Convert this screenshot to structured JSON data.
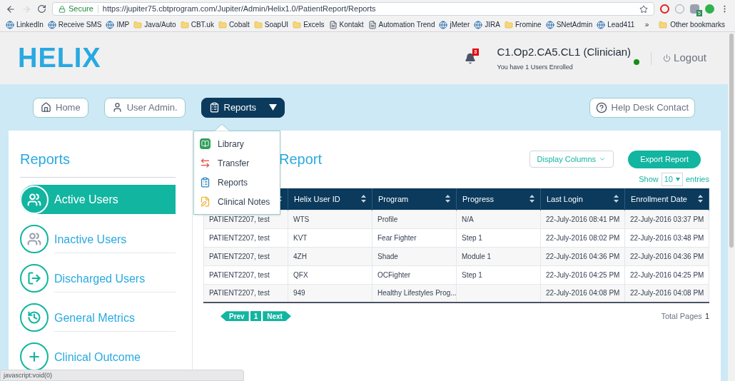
{
  "browser": {
    "secure_label": "Secure",
    "url": "https://jupiter75.cbtprogram.com/Jupiter/Admin/Helix1.0/PatientReport/Reports",
    "extension_badge": "5",
    "bookmarks": [
      {
        "label": "LinkedIn",
        "kind": "site"
      },
      {
        "label": "Receive SMS",
        "kind": "site"
      },
      {
        "label": "IMP",
        "kind": "site"
      },
      {
        "label": "Java/Auto",
        "kind": "folder"
      },
      {
        "label": "CBT.uk",
        "kind": "folder"
      },
      {
        "label": "Cobalt",
        "kind": "folder"
      },
      {
        "label": "SoapUI",
        "kind": "folder"
      },
      {
        "label": "Excels",
        "kind": "folder"
      },
      {
        "label": "Kontakt",
        "kind": "page"
      },
      {
        "label": "Automation Trend",
        "kind": "page"
      },
      {
        "label": "jMeter",
        "kind": "site"
      },
      {
        "label": "JIRA",
        "kind": "site"
      },
      {
        "label": "Fromine",
        "kind": "folder"
      },
      {
        "label": "SNetAdmin",
        "kind": "site"
      },
      {
        "label": "Lead411",
        "kind": "site"
      }
    ],
    "overflow": "»",
    "other_bookmarks": "Other bookmarks"
  },
  "header": {
    "logo": "HELIX",
    "notification_count": "3",
    "user": "C1.Op2.CA5.CL1 (Clinician)",
    "online": true,
    "enrolled": "You have 1 Users Enrolled",
    "logout": "Logout"
  },
  "nav": [
    {
      "label": "Home",
      "kind": "home",
      "selected": false,
      "dropdown": false
    },
    {
      "label": "User Admin.",
      "kind": "user",
      "selected": false,
      "dropdown": false
    },
    {
      "label": "Reports",
      "kind": "clipboard",
      "selected": true,
      "dropdown": true
    }
  ],
  "help_button": "Help Desk Contact",
  "reports_menu": [
    {
      "label": "Library",
      "kind": "library"
    },
    {
      "label": "Transfer",
      "kind": "transfer"
    },
    {
      "label": "Reports",
      "kind": "clipboard"
    },
    {
      "label": "Clinical Notes",
      "kind": "notes"
    }
  ],
  "sidebar": {
    "title": "Reports",
    "items": [
      {
        "label": "Active Users",
        "kind": "users",
        "selected": true
      },
      {
        "label": "Inactive Users",
        "kind": "users-grey",
        "selected": false
      },
      {
        "label": "Discharged Users",
        "kind": "exit",
        "selected": false
      },
      {
        "label": "General Metrics",
        "kind": "history",
        "selected": false
      },
      {
        "label": "Clinical Outcome",
        "kind": "plus",
        "selected": false
      }
    ]
  },
  "report": {
    "title": "Report",
    "display_columns": "Display Columns",
    "export": "Export Report",
    "show": "Show",
    "entries_value": "10",
    "entries": "entries",
    "columns": [
      {},
      {
        "label": "Helix User ID"
      },
      {
        "label": "Program"
      },
      {
        "label": "Progress"
      },
      {
        "label": "Last Login"
      },
      {
        "label": "Enrollment Date"
      }
    ],
    "rows": [
      [
        "PATIENT2207, test",
        "WTS",
        "Profile",
        "N/A",
        "22-July-2016 08:41 PM",
        "22-July-2016 03:37 PM"
      ],
      [
        "PATIENT2207, test",
        "KVT",
        "Fear Fighter",
        "Step 1",
        "22-July-2016 08:02 PM",
        "22-July-2016 03:48 PM"
      ],
      [
        "PATIENT2207, test",
        "4ZH",
        "Shade",
        "Module 1",
        "22-July-2016 04:36 PM",
        "22-July-2016 04:36 PM"
      ],
      [
        "PATIENT2207, test",
        "QFX",
        "OCFighter",
        "Step 1",
        "22-July-2016 04:25 PM",
        "22-July-2016 04:25 PM"
      ],
      [
        "PATIENT2207, test",
        "949",
        "Healthy Lifestyles Prog...",
        "",
        "22-July-2016 04:08 PM",
        "22-July-2016 04:08 PM"
      ]
    ],
    "pagination": {
      "prev": "Prev",
      "page": "1",
      "next": "Next"
    },
    "total_pages_label": "Total Pages",
    "total_pages": "1"
  },
  "status_bar": "javascript:void(0)"
}
